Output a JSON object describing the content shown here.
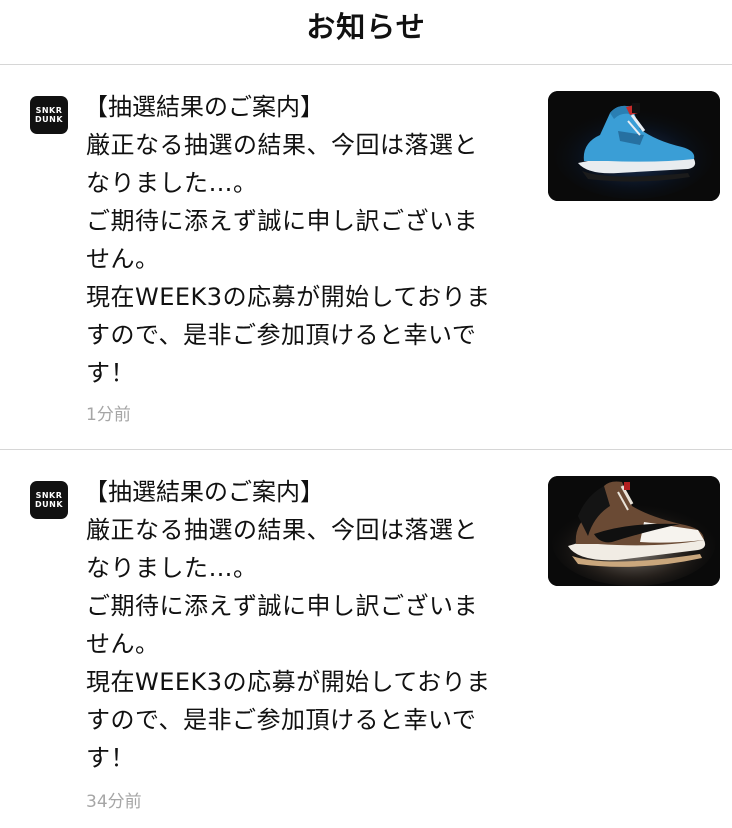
{
  "header": {
    "title": "お知らせ"
  },
  "app_icon": {
    "line1": "SNKR",
    "line2": "DUNK"
  },
  "notifications": [
    {
      "title": "【抽選結果のご案内】",
      "body": "厳正なる抽選の結果、今回は落選と\nなりました…。\nご期待に添えず誠に申し訳ございま\nせん。\n現在WEEK3の応募が開始しておりま\nすので、是非ご参加頂けると幸いで\nす！",
      "time": "1分前",
      "thumbnail_icon": "blue-sneaker-image"
    },
    {
      "title": "【抽選結果のご案内】",
      "body": "厳正なる抽選の結果、今回は落選と\nなりました…。\nご期待に添えず誠に申し訳ございま\nせん。\n現在WEEK3の応募が開始しておりま\nすので、是非ご参加頂けると幸いで\nす！",
      "time": "34分前",
      "thumbnail_icon": "brown-sneaker-image"
    }
  ],
  "colors": {
    "divider": "#d6d6d6",
    "timestamp": "#a6a6a6",
    "icon_bg": "#111111"
  }
}
